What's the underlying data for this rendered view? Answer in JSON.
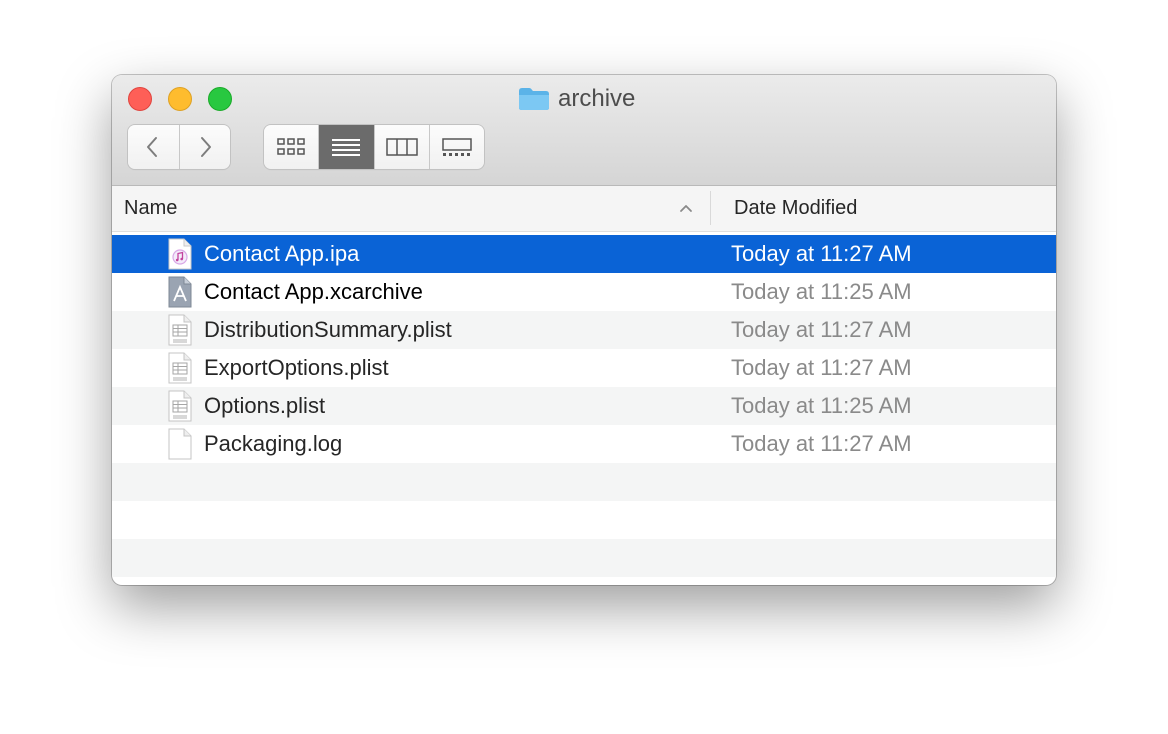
{
  "window": {
    "title": "archive",
    "title_icon": "folder-icon",
    "traffic_lights": {
      "close": "#fe5f57",
      "minimize": "#febc2e",
      "maximize": "#28c840"
    }
  },
  "toolbar": {
    "nav": [
      "back-icon",
      "forward-icon"
    ],
    "view_modes": [
      "icon-view",
      "list-view",
      "column-view",
      "gallery-view"
    ],
    "active_view": "list-view"
  },
  "columns": {
    "name": "Name",
    "date_modified": "Date Modified",
    "sort": "ascending"
  },
  "files": [
    {
      "name": "Contact App.ipa",
      "date": "Today at 11:27 AM",
      "icon": "ipa-file-icon",
      "selected": true
    },
    {
      "name": "Contact App.xcarchive",
      "date": "Today at 11:25 AM",
      "icon": "xcarchive-icon",
      "selected": false
    },
    {
      "name": "DistributionSummary.plist",
      "date": "Today at 11:27 AM",
      "icon": "plist-file-icon",
      "selected": false
    },
    {
      "name": "ExportOptions.plist",
      "date": "Today at 11:27 AM",
      "icon": "plist-file-icon",
      "selected": false
    },
    {
      "name": "Options.plist",
      "date": "Today at 11:25 AM",
      "icon": "plist-file-icon",
      "selected": false
    },
    {
      "name": "Packaging.log",
      "date": "Today at 11:27 AM",
      "icon": "log-file-icon",
      "selected": false
    }
  ],
  "colors": {
    "selection": "#0a63d6",
    "alt_row": "#f4f5f5",
    "active_view_bg": "#6b6b6b"
  }
}
